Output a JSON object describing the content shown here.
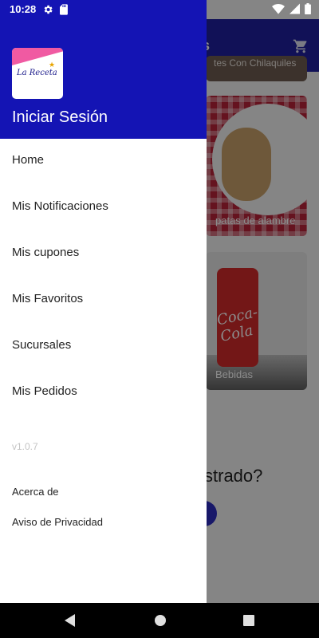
{
  "status_bar": {
    "time": "10:28",
    "icons": [
      "settings-icon",
      "sd-card-icon",
      "wifi-icon",
      "signal-icon",
      "battery-icon"
    ]
  },
  "background": {
    "title": "iles",
    "cart_icon": "shopping-cart-icon",
    "cards": [
      {
        "label": "tes Con Chilaquiles"
      },
      {
        "label": "patas de alambre"
      },
      {
        "label": "Bebidas"
      }
    ],
    "can_logo": "Coca-Cola",
    "question": "strado?"
  },
  "drawer": {
    "logo_text": "La Receta",
    "header_title": "Iniciar Sesión",
    "menu_items": [
      {
        "label": "Home"
      },
      {
        "label": "Mis Notificaciones"
      },
      {
        "label": "Mis cupones"
      },
      {
        "label": "Mis Favoritos"
      },
      {
        "label": "Sucursales"
      },
      {
        "label": "Mis Pedidos"
      }
    ],
    "version": "v1.0.7",
    "links": [
      {
        "label": "Acerca de"
      },
      {
        "label": "Aviso de Privacidad"
      }
    ]
  },
  "nav_bar": {
    "buttons": [
      "back-icon",
      "home-icon",
      "recents-icon"
    ]
  },
  "colors": {
    "drawer_header": "#1414b4",
    "app_bar": "#1f1f9e",
    "nav_bar": "#000000"
  }
}
